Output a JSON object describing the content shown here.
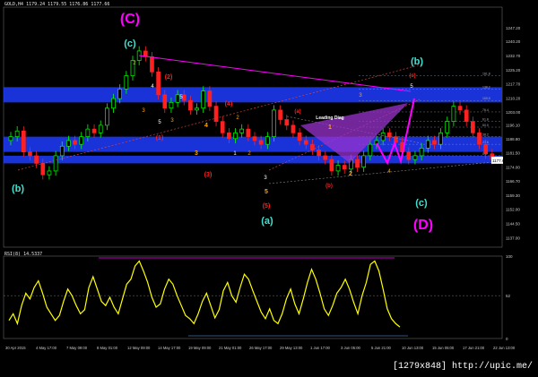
{
  "header": {
    "symbol_line": "GOLD,H4  1179.24 1179.55 1176.86 1177.66",
    "rsi_line": "RSI(8) 14.5337"
  },
  "watermark": "[1279x848] http://upic.me/",
  "colors": {
    "background": "#000000",
    "bull_candle": "#00ff00",
    "bear_candle": "#ff2020",
    "zone": "#1e3cff",
    "rsi": "#ffff00",
    "triangle": "#ff00ff",
    "diag": "#9933cc",
    "cyan_label": "#40e0d0",
    "magenta_label": "#ff00ff",
    "red_label": "#ff2020",
    "orange_label": "#ffa500"
  },
  "chart_data": [
    {
      "type": "candlestick",
      "title": "GOLD,H4",
      "ohlc_header": [
        "1179.24",
        "1179.55",
        "1176.86",
        "1177.66"
      ],
      "ylim": [
        1132,
        1258
      ],
      "y_ticks": [
        "1247.20",
        "1240.20",
        "1232.70",
        "1225.20",
        "1217.70",
        "1210.20",
        "1203.00",
        "1196.10",
        "1188.80",
        "1181.50",
        "1174.00",
        "1166.70",
        "1159.30",
        "1152.00",
        "1144.50",
        "1137.00"
      ],
      "price_marker": "1177.66",
      "x_tick_labels": [
        "30 Apr 2015",
        "4 May 17:00",
        "7 May 09:00",
        "8 May 01:00",
        "12 May 09:00",
        "14 May 17:00",
        "19 May 09:00",
        "21 May 01:00",
        "26 May 17:00",
        "29 May 13:00",
        "1 Jun 17:00",
        "3 Jun 05:00",
        "5 Jun 21:00",
        "10 Jun 13:00",
        "15 Jun 05:00",
        "17 Jun 21:00",
        "22 Jun 13:00"
      ],
      "close_path": [
        1190,
        1193,
        1182,
        1180,
        1176,
        1170,
        1172,
        1180,
        1185,
        1188,
        1186,
        1190,
        1194,
        1192,
        1196,
        1205,
        1210,
        1215,
        1222,
        1230,
        1235,
        1232,
        1224,
        1212,
        1205,
        1208,
        1212,
        1209,
        1204,
        1205,
        1214,
        1206,
        1198,
        1192,
        1189,
        1192,
        1194,
        1190,
        1188,
        1186,
        1190,
        1204,
        1199,
        1196,
        1192,
        1188,
        1186,
        1183,
        1180,
        1178,
        1172,
        1175,
        1173,
        1178,
        1174,
        1180,
        1186,
        1188,
        1192,
        1190,
        1187,
        1182,
        1178,
        1180,
        1184,
        1188,
        1186,
        1192,
        1198,
        1206,
        1204,
        1198,
        1192,
        1186,
        1181,
        1178
      ],
      "annotations": {
        "wave_C": "(C)",
        "wave_c_cyan": "(c)",
        "wave_b_cyan": "(b)",
        "wave_a_cyan": "(a)",
        "wave_b_left": "(b)",
        "wave_c_right": "(c)",
        "wave_D": "(D)",
        "red_2": "(2)",
        "red_1": "(1)",
        "red_3": "(3)",
        "red_4": "(4)",
        "red_5": "(5)",
        "red_a": "(a)",
        "red_b": "(b)",
        "red_c": "(c)",
        "orange_3": "3",
        "orange_4": "4",
        "orange_5": "5",
        "orange_2": "2",
        "orange_1": "1",
        "leading_diag": "Leading Diag"
      },
      "zones": [
        {
          "low": 1208,
          "high": 1216
        },
        {
          "low": 1182,
          "high": 1190
        },
        {
          "low": 1176,
          "high": 1180
        }
      ],
      "fib_labels": [
        "161.8",
        "138.2",
        "100.0",
        "76.4",
        "61.8",
        "50.0",
        "38.2",
        "23.6",
        "0.0"
      ]
    },
    {
      "type": "line",
      "title": "RSI(8) 14.5337",
      "ylim": [
        0,
        100
      ],
      "y_ticks": [
        "100",
        "52",
        "0"
      ],
      "values": [
        22,
        30,
        18,
        40,
        55,
        48,
        62,
        70,
        55,
        38,
        30,
        22,
        28,
        45,
        60,
        52,
        40,
        30,
        35,
        62,
        75,
        60,
        45,
        40,
        50,
        38,
        30,
        48,
        66,
        72,
        88,
        94,
        82,
        68,
        50,
        38,
        42,
        60,
        72,
        66,
        52,
        40,
        28,
        24,
        18,
        30,
        45,
        55,
        40,
        25,
        35,
        58,
        68,
        52,
        44,
        62,
        78,
        72,
        58,
        45,
        32,
        24,
        36,
        22,
        18,
        30,
        48,
        60,
        42,
        30,
        48,
        68,
        84,
        72,
        55,
        36,
        28,
        40,
        55,
        62,
        72,
        60,
        44,
        30,
        52,
        68,
        90,
        94,
        82,
        60,
        36,
        24,
        18,
        14
      ]
    }
  ]
}
